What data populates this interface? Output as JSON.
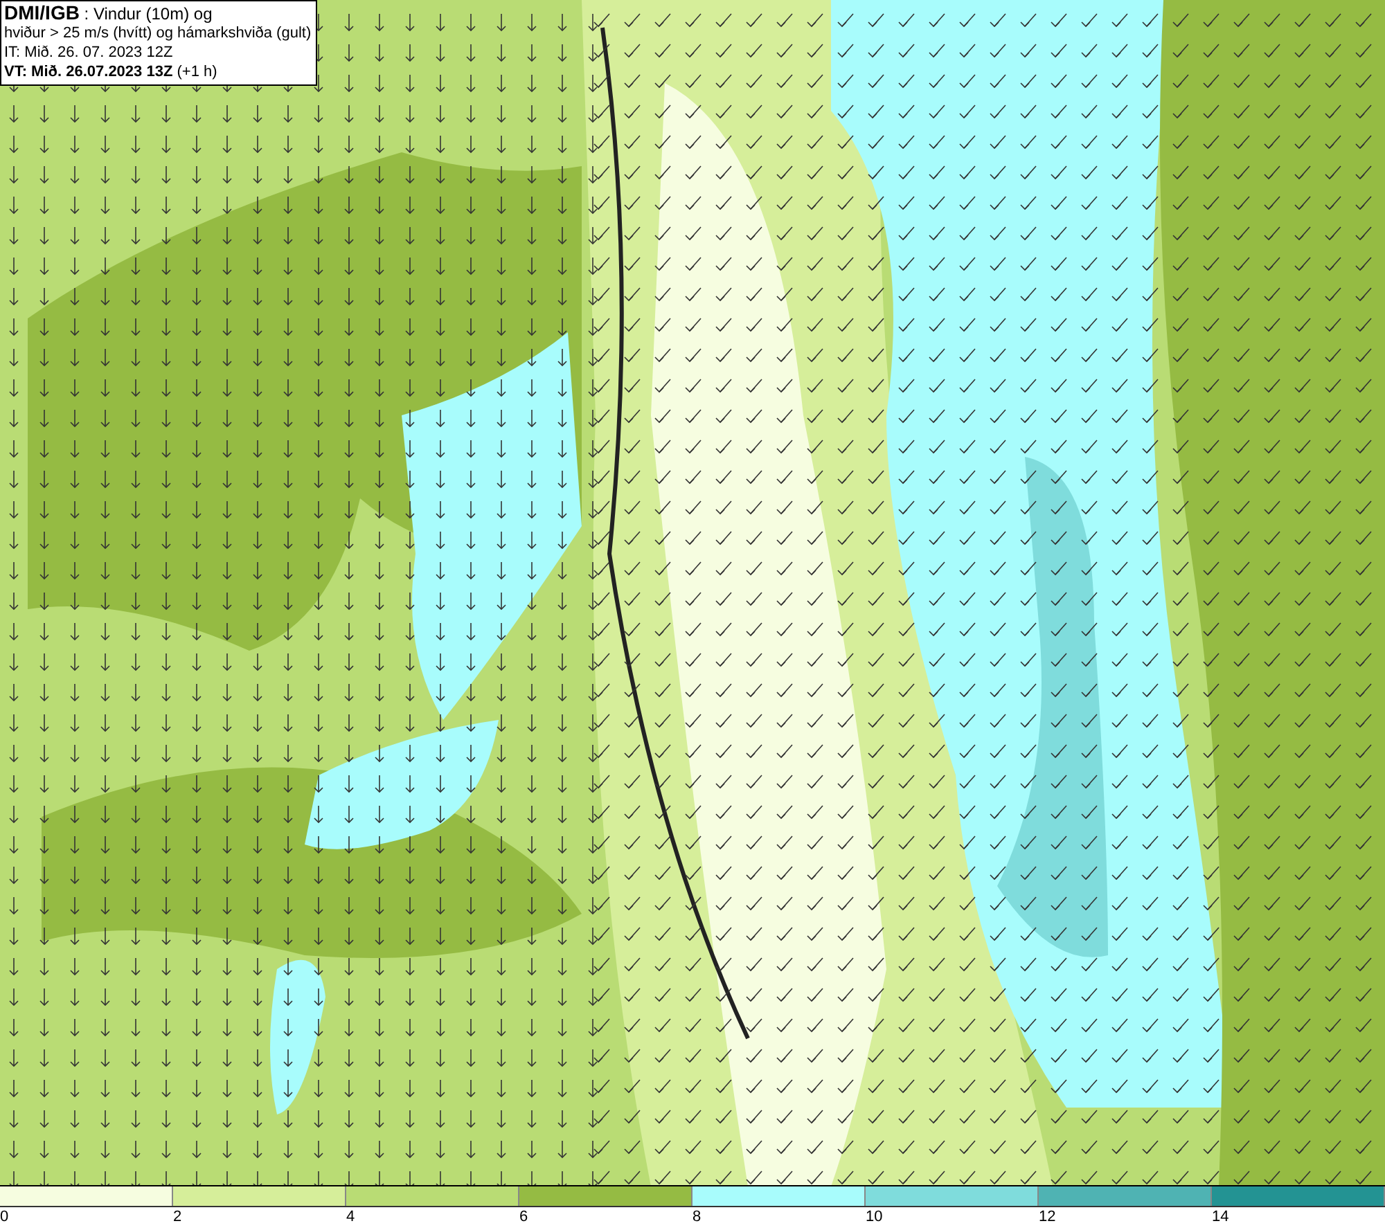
{
  "info_box": {
    "lines": [
      "**DMI/IGB** : Vindur (10m) og",
      "hviður > 25 m/s (hvítt) og hámarkshviða (gult)",
      "IT: Mið. 26. 07. 2023 12Z",
      "**VT: Mið. 26.07.2023 13Z** (+1 h)"
    ]
  },
  "legend": {
    "swatches": [
      {
        "color": "#f6fde0"
      },
      {
        "color": "#d6ee9a"
      },
      {
        "color": "#b9dc74"
      },
      {
        "color": "#95bb43"
      },
      {
        "color": "#a8fcfc"
      },
      {
        "color": "#7fdcdc"
      },
      {
        "color": "#4fb3b3"
      },
      {
        "color": "#239393"
      }
    ],
    "ticks": [
      "0",
      "2",
      "4",
      "6",
      "8",
      "10",
      "12",
      "14"
    ]
  }
}
